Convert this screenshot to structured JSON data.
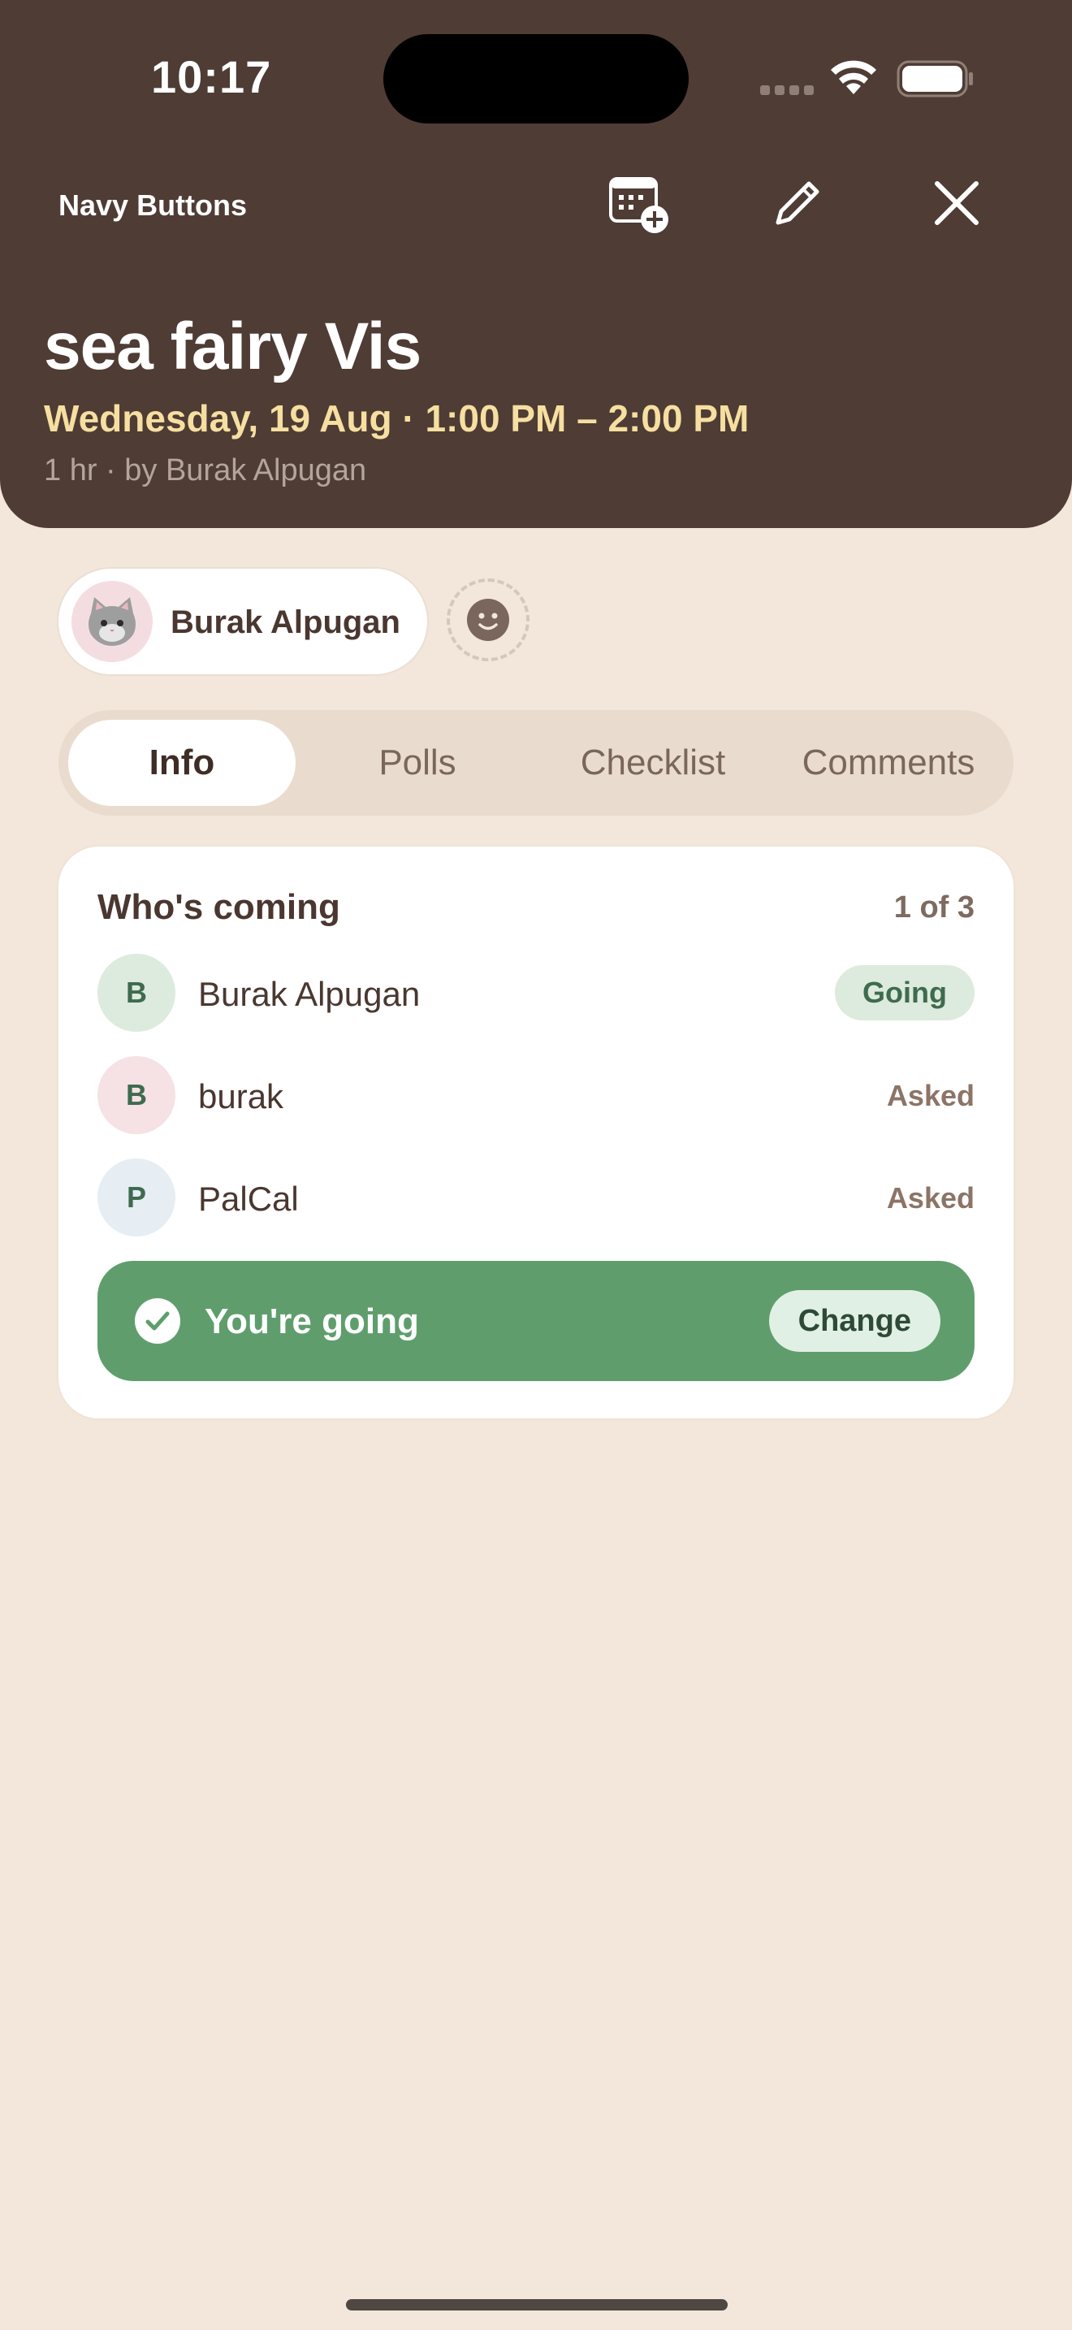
{
  "status_bar": {
    "time": "10:17"
  },
  "header": {
    "app_name": "Navy Buttons",
    "title": "sea fairy Vis",
    "when": "Wednesday, 19 Aug · 1:00 PM – 2:00 PM",
    "meta": "1 hr · by Burak Alpugan",
    "icons": [
      "calendar-add-icon",
      "pencil-icon",
      "close-icon"
    ],
    "colors": {
      "background": "#4E3C35",
      "when_text": "#F6DFA0"
    }
  },
  "host": {
    "name": "Burak Alpugan",
    "avatar": "cat-avatar"
  },
  "tabs": [
    {
      "label": "Info",
      "active": true
    },
    {
      "label": "Polls",
      "active": false
    },
    {
      "label": "Checklist",
      "active": false
    },
    {
      "label": "Comments",
      "active": false
    }
  ],
  "attendance": {
    "title": "Who's coming",
    "count": "1 of 3",
    "people": [
      {
        "initial": "B",
        "name": "Burak Alpugan",
        "status": "Going",
        "avatar_color": "#DCEBDD"
      },
      {
        "initial": "B",
        "name": "burak",
        "status": "Asked",
        "avatar_color": "#F6E1E4"
      },
      {
        "initial": "P",
        "name": "PalCal",
        "status": "Asked",
        "avatar_color": "#E6EDF3"
      }
    ],
    "rsvp": {
      "text": "You're going",
      "button": "Change",
      "color": "#5F9E6C"
    }
  }
}
